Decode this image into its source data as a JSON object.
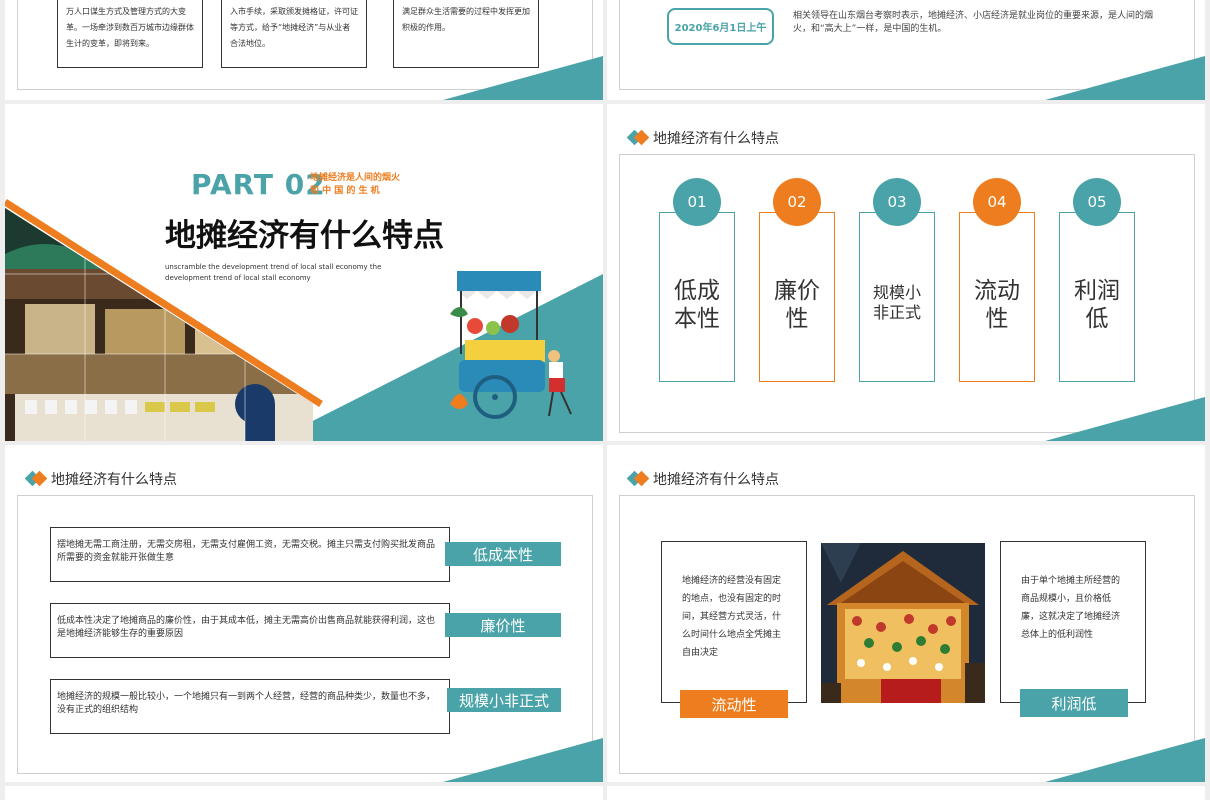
{
  "slide1": {
    "box1_text": "万人口谋生方式及管理方式的大变革。一场牵涉到数百万城市边缘群体生计的变革，即将到来。",
    "box2_text": "入市手续，采取颁发摊格证，许可证等方式，给予“地摊经济”与从业者合法地位。",
    "box3_text": "满足群众生活需要的过程中发挥更加积极的作用。"
  },
  "slide2": {
    "date": "2020年6月1日上午",
    "desc": "相关领导在山东烟台考察时表示，地摊经济、小店经济是就业岗位的重要来源，是人间的烟火，和“高大上”一样，是中国的生机。"
  },
  "slide3": {
    "part": "PART 02",
    "part_sub_1": "地摊经济是人间的烟火",
    "part_sub_2": "和 中 国 的 生 机",
    "title": "地摊经济有什么特点",
    "subtitle_en": "unscramble the development trend of local stall economy the development trend of local stall economy"
  },
  "slide4": {
    "heading": "地摊经济有什么特点",
    "features": [
      {
        "num": "01",
        "label_1": "低成",
        "label_2": "本性",
        "color": "teal"
      },
      {
        "num": "02",
        "label_1": "廉价",
        "label_2": "性",
        "color": "orange"
      },
      {
        "num": "03",
        "label_1": "规模小",
        "label_2": "非正式",
        "color": "teal"
      },
      {
        "num": "04",
        "label_1": "流动",
        "label_2": "性",
        "color": "orange"
      },
      {
        "num": "05",
        "label_1": "利润",
        "label_2": "低",
        "color": "teal"
      }
    ]
  },
  "slide5": {
    "heading": "地摊经济有什么特点",
    "rows": [
      {
        "text": "摆地摊无需工商注册，无需交房租，无需支付雇佣工资，无需交税。摊主只需支付购买批发商品所需要的资金就能开张做生意",
        "tag": "低成本性"
      },
      {
        "text": "低成本性决定了地摊商品的廉价性，由于其成本低，摊主无需高价出售商品就能获得利润，这也是地摊经济能够生存的重要原因",
        "tag": "廉价性"
      },
      {
        "text": "地摊经济的规模一般比较小，一个地摊只有一到两个人经营，经营的商品种类少，数量也不多，没有正式的组织结构",
        "tag": "规模小非正式"
      }
    ]
  },
  "slide6": {
    "heading": "地摊经济有什么特点",
    "left_text": "地摊经济的经营没有固定的地点，也没有固定的时间，其经营方式灵活，什么时间什么地点全凭摊主自由决定",
    "left_tag": "流动性",
    "right_text": "由于单个地摊主所经营的商品规模小，且价格低廉，这就决定了地摊经济总体上的低利润性",
    "right_tag": "利润低"
  },
  "colors": {
    "teal": "#4aa3a8",
    "orange": "#ee7d1f"
  }
}
